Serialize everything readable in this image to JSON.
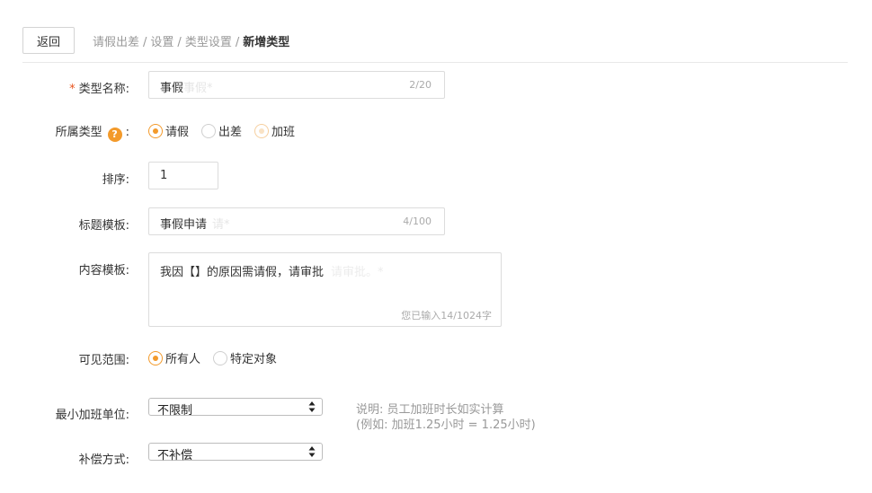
{
  "header": {
    "back_label": "返回",
    "breadcrumb": [
      "请假出差",
      "设置",
      "类型设置",
      "新增类型"
    ],
    "separator": "/"
  },
  "form": {
    "type_name": {
      "label": "类型名称:",
      "required_mark": "*",
      "value": "事假",
      "ghost": "事假*",
      "count": "2/20"
    },
    "category": {
      "label": "所属类型",
      "help_glyph": "?",
      "colon": ":",
      "options": [
        "请假",
        "出差",
        "加班"
      ],
      "selected": "请假"
    },
    "sort": {
      "label": "排序:",
      "value": "1"
    },
    "title_template": {
      "label": "标题模板:",
      "value": "事假申请",
      "ghost": "请*",
      "count": "4/100"
    },
    "content_template": {
      "label": "内容模板:",
      "value": "我因【】的原因需请假，请审批",
      "ghost": "请审批。*",
      "count": "您已输入14/1024字"
    },
    "visibility": {
      "label": "可见范围:",
      "options": [
        "所有人",
        "特定对象"
      ],
      "selected": "所有人"
    },
    "min_unit": {
      "label": "最小加班单位:",
      "value": "不限制"
    },
    "note": {
      "line1": "说明:  员工加班时长如实计算",
      "line2": "(例如:  加班1.25小时 = 1.25小时)"
    },
    "compensation": {
      "label": "补偿方式:",
      "value": "不补偿"
    }
  },
  "colors": {
    "accent": "#f39a2b",
    "required": "#e8541e"
  },
  "icons": {
    "help": "question-circle-icon",
    "select_arrows": "updown-arrows-icon"
  }
}
